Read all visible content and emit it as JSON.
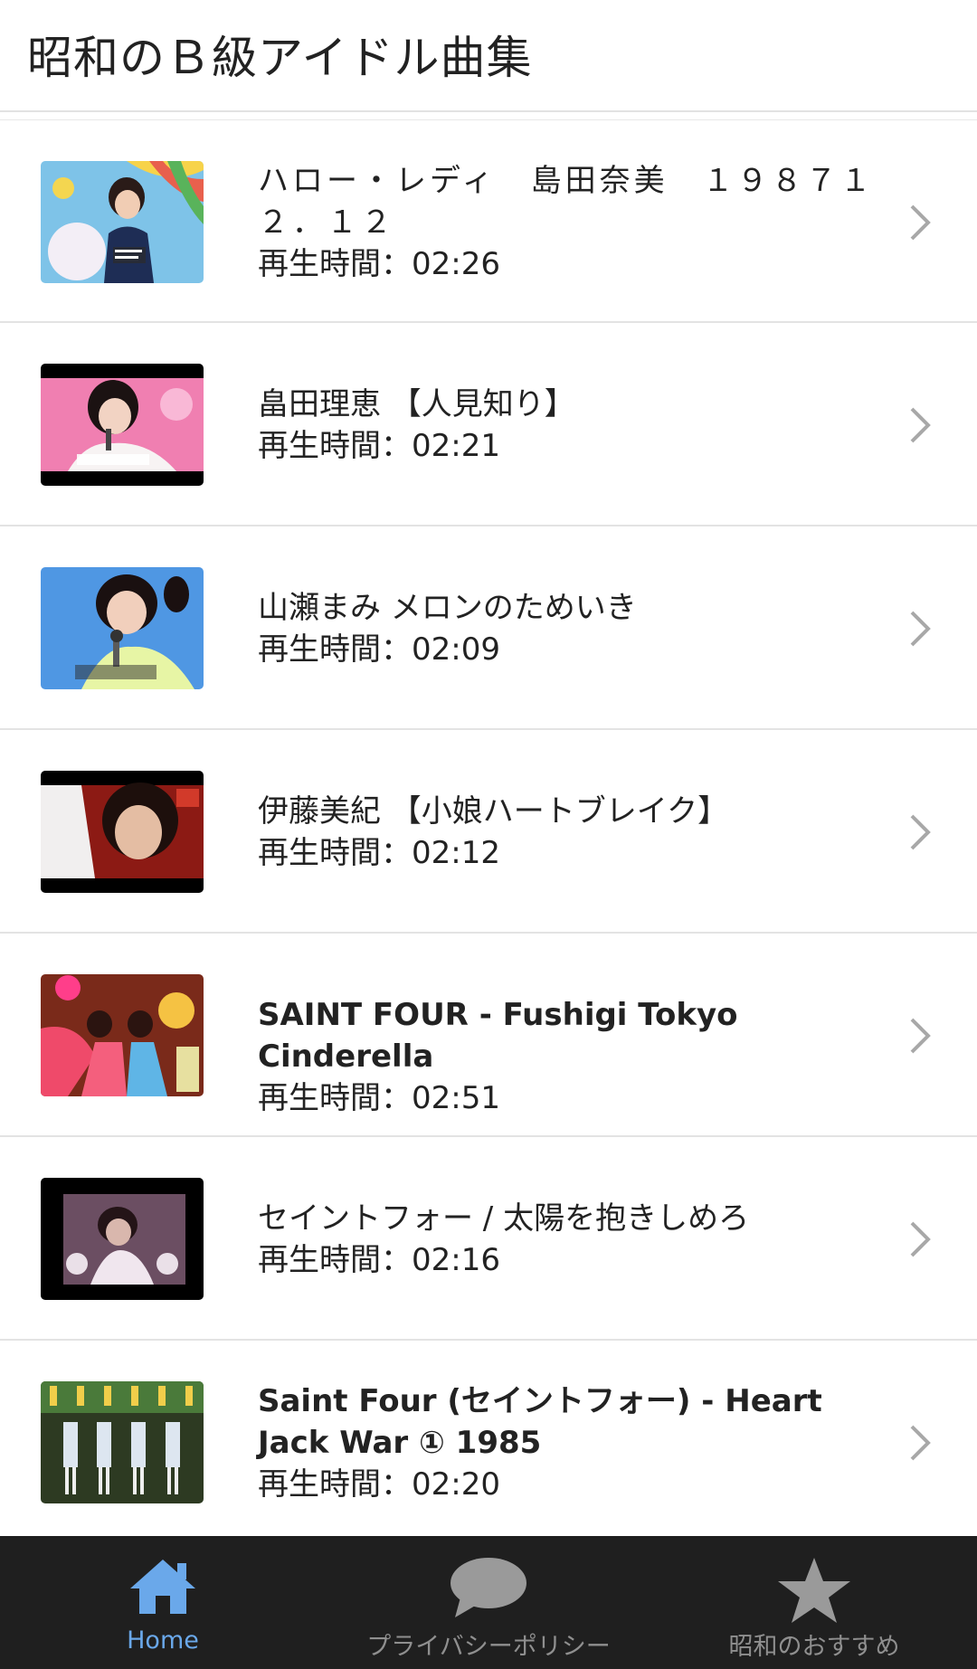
{
  "app": {
    "title": "昭和のＢ級アイドル曲集"
  },
  "videos": [
    {
      "title": "ハロー・レディ　島田奈美　１９８７１２．１２",
      "duration": "再生時間：02:26"
    },
    {
      "title": "畠田理恵 【人見知り】",
      "duration": "再生時間：02:21"
    },
    {
      "title": "山瀬まみ メロンのためいき",
      "duration": "再生時間：02:09"
    },
    {
      "title": "伊藤美紀 【小娘ハートブレイク】",
      "duration": "再生時間：02:12"
    },
    {
      "title": "SAINT FOUR - Fushigi Tokyo Cinderella",
      "duration": "再生時間：02:51"
    },
    {
      "title": "セイントフォー / 太陽を抱きしめろ",
      "duration": "再生時間：02:16"
    },
    {
      "title": "Saint Four (セイントフォー) - Heart Jack War ① 1985",
      "duration": "再生時間：02:20"
    }
  ],
  "tabs": [
    {
      "label": "Home",
      "icon": "home-icon",
      "active": true
    },
    {
      "label": "プライバシーポリシー",
      "icon": "chat-bubble-icon",
      "active": false
    },
    {
      "label": "昭和のおすすめ",
      "icon": "star-icon",
      "active": false
    }
  ],
  "colors": {
    "active_tab": "#6aa8ea",
    "inactive_tab": "#8f8f8f",
    "tab_bar_bg": "#1f1f1f",
    "chevron": "#a8a8a8"
  }
}
